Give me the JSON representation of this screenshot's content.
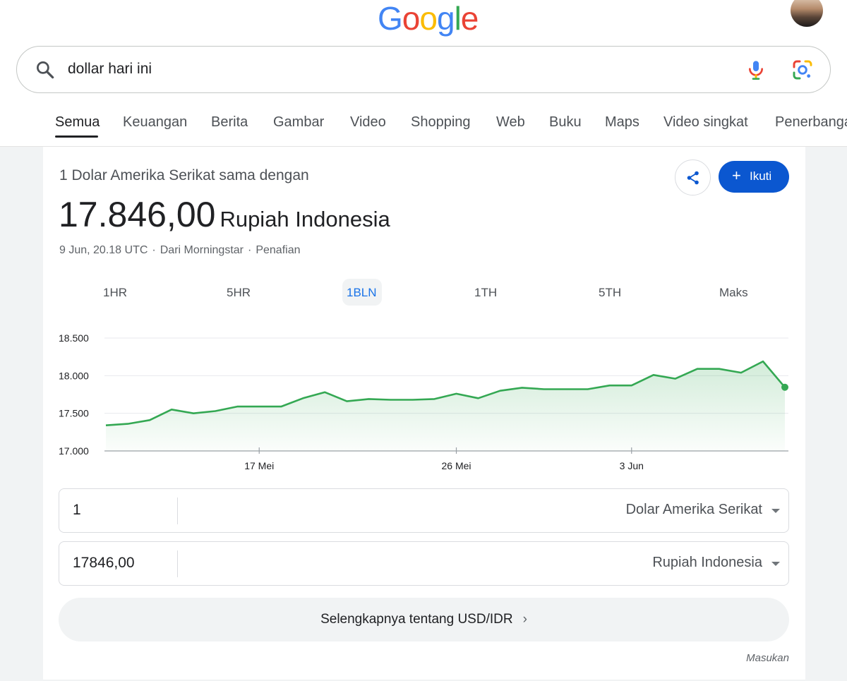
{
  "header": {
    "logo_letters": [
      "G",
      "o",
      "o",
      "g",
      "l",
      "e"
    ]
  },
  "search": {
    "query": "dollar hari ini"
  },
  "tabs": [
    {
      "label": "Semua",
      "active": true
    },
    {
      "label": "Keuangan"
    },
    {
      "label": "Berita"
    },
    {
      "label": "Gambar"
    },
    {
      "label": "Video"
    },
    {
      "label": "Shopping"
    },
    {
      "label": "Web"
    },
    {
      "label": "Buku"
    },
    {
      "label": "Maps"
    },
    {
      "label": "Video singkat"
    },
    {
      "label": "Penerbangan"
    }
  ],
  "card": {
    "subtitle": "1 Dolar Amerika Serikat sama dengan",
    "value": "17.846,00",
    "currency": "Rupiah Indonesia",
    "timestamp": "9 Jun, 20.18 UTC",
    "source": "Dari Morningstar",
    "disclaimer": "Penafian",
    "follow_label": "Ikuti"
  },
  "ranges": [
    {
      "label": "1HR"
    },
    {
      "label": "5HR"
    },
    {
      "label": "1BLN",
      "active": true
    },
    {
      "label": "1TH"
    },
    {
      "label": "5TH"
    },
    {
      "label": "Maks"
    }
  ],
  "converter": {
    "from_amount": "1",
    "from_currency": "Dolar Amerika Serikat",
    "to_amount": "17846,00",
    "to_currency": "Rupiah Indonesia"
  },
  "more_label": "Selengkapnya tentang USD/IDR",
  "feedback_label": "Masukan",
  "colors": {
    "line": "#34a853",
    "accent": "#0b57d0",
    "active_range": "#1a73e8"
  },
  "chart_data": {
    "type": "area",
    "ylim": [
      17000,
      18500
    ],
    "y_ticks": [
      17000,
      17500,
      18000,
      18500
    ],
    "y_tick_labels": [
      "17.000",
      "17.500",
      "18.000",
      "18.500"
    ],
    "x_ticks": [
      {
        "label": "17 Mei",
        "index": 7
      },
      {
        "label": "26 Mei",
        "index": 16
      },
      {
        "label": "3 Jun",
        "index": 24
      }
    ],
    "grid": true,
    "series": [
      {
        "values": [
          17340,
          17360,
          17410,
          17550,
          17500,
          17530,
          17590,
          17590,
          17590,
          17700,
          17780,
          17660,
          17690,
          17680,
          17680,
          17690,
          17760,
          17700,
          17800,
          17840,
          17820,
          17820,
          17820,
          17870,
          17870,
          18010,
          17960,
          18090,
          18090,
          18040,
          18190,
          17846
        ]
      }
    ]
  }
}
